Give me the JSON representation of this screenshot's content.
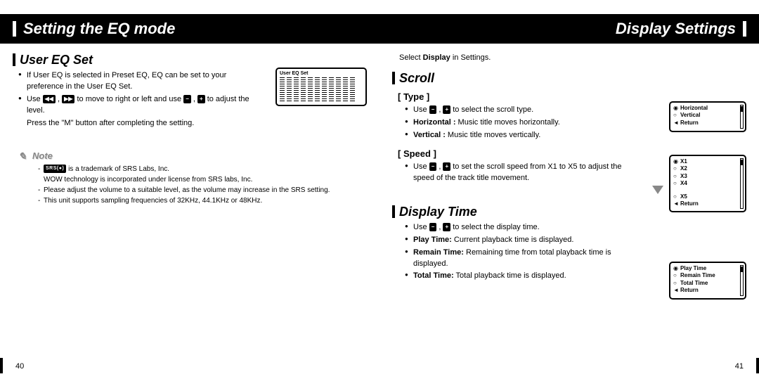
{
  "left": {
    "header": "Setting the EQ mode",
    "section1_title": "User EQ Set",
    "bullets1": [
      "If User EQ is selected in Preset EQ, EQ can be set to your preference in the User EQ Set.",
      "Use ◀◀ , ▶▶ to move to right or left and use − , + to adjust the level."
    ],
    "press_m": "Press the \"M\" button after completing the setting.",
    "note_label": "Note",
    "notes": [
      "is a trademark of SRS Labs, Inc.",
      "WOW technology is incorporated under license from SRS labs, Inc.",
      "Please adjust the volume to a suitable level, as the volume may increase in the SRS setting.",
      "This unit supports sampling frequencies of 32KHz, 44.1KHz or 48KHz."
    ],
    "notes_prefix_srs": "SRS(●)",
    "eq_title": "User EQ Set",
    "page_number": "40"
  },
  "right": {
    "header": "Display Settings",
    "intro": "Select Display in Settings.",
    "intro_bold": "Display",
    "section1_title": "Scroll",
    "sub1": "[ Type ]",
    "type_bullets": [
      "Use − , + to select the scroll type.",
      "Horizontal : Music title moves horizontally.",
      "Vertical : Music title moves vertically."
    ],
    "sub2": "[ Speed ]",
    "speed_bullets": [
      "Use − , + to set the scroll speed from X1 to X5 to adjust the speed of the track title movement."
    ],
    "section2_title": "Display Time",
    "time_bullets": [
      "Use − , + to select the display time.",
      "Play Time: Current playback time is displayed.",
      "Remain Time: Remaining time from total playback time is displayed.",
      "Total Time: Total playback time is displayed."
    ],
    "screen1": {
      "items": [
        "Horizontal",
        "Vertical",
        "Return"
      ],
      "selected": 0
    },
    "screen2": {
      "items": [
        "X1",
        "X2",
        "X3",
        "X4",
        "X5",
        "Return"
      ],
      "selected": 0,
      "gap_after": 3
    },
    "screen3": {
      "items": [
        "Play Time",
        "Remain Time",
        "Total Time",
        "Return"
      ],
      "selected": 0
    },
    "page_number": "41"
  }
}
